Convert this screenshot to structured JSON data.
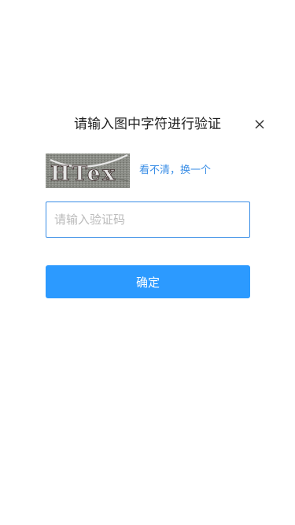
{
  "dialog": {
    "title": "请输入图中字符进行验证",
    "close_icon": "close-icon"
  },
  "captcha": {
    "image_text": "HTex",
    "refresh_label": "看不清，换一个"
  },
  "input": {
    "value": "",
    "placeholder": "请输入验证码"
  },
  "confirm": {
    "label": "确定"
  },
  "colors": {
    "accent": "#2c9aff",
    "link": "#3a8ee6",
    "title_text": "#222222",
    "placeholder": "#bbbbbb"
  }
}
